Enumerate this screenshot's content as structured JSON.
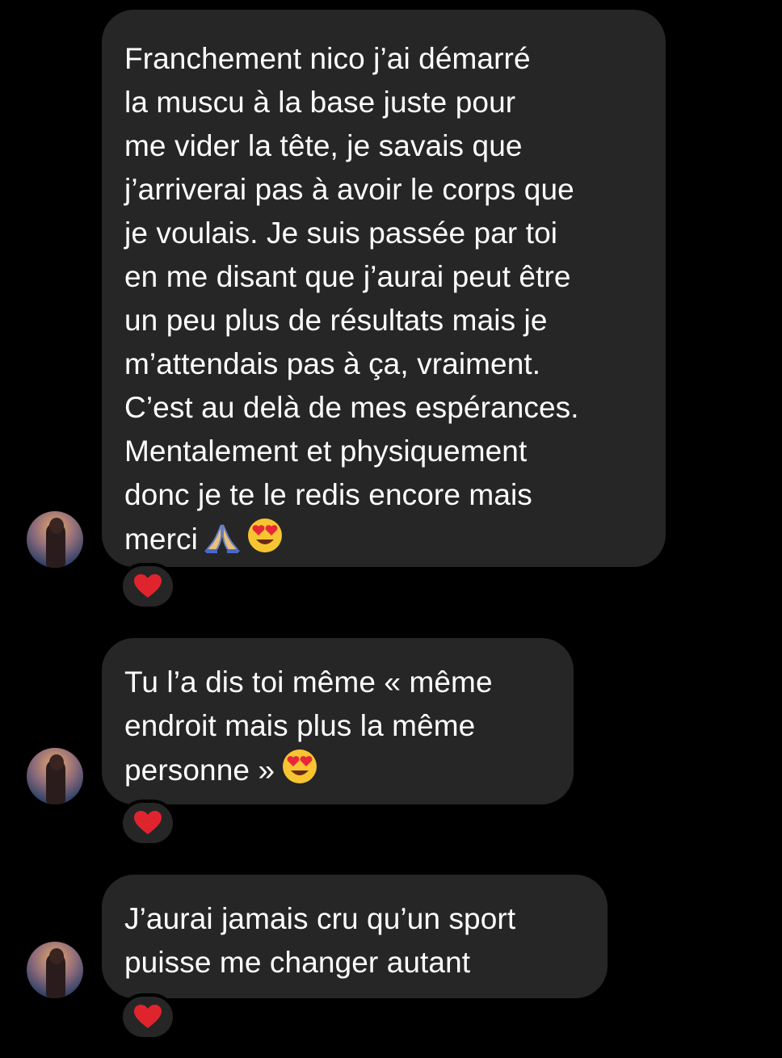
{
  "messages": [
    {
      "lines": [
        "Franchement nico j’ai démarré",
        "la muscu à la base juste pour",
        "me vider la tête, je savais que",
        "j’arriverai pas à avoir le corps que",
        "je voulais. Je suis passée par toi",
        "en me disant que j’aurai peut être",
        "un peu plus de résultats mais je",
        "m’attendais pas à ça, vraiment.",
        "C’est au delà de mes espérances.",
        "Mentalement et physiquement",
        "donc je te le redis encore mais",
        "merci"
      ],
      "trailing_emojis": [
        "folded-hands-icon",
        "heart-eyes-icon"
      ],
      "reaction": "red-heart-icon"
    },
    {
      "lines": [
        "Tu l’a dis toi même « même",
        "endroit mais plus la même",
        "personne »"
      ],
      "trailing_emojis": [
        "heart-eyes-icon"
      ],
      "reaction": "red-heart-icon"
    },
    {
      "lines": [
        "J’aurai jamais cru qu’un sport",
        "puisse me changer autant"
      ],
      "trailing_emojis": [],
      "reaction": "red-heart-icon"
    }
  ],
  "colors": {
    "background": "#000000",
    "bubble": "#262626",
    "text": "#ffffff",
    "heart": "#e0242e",
    "emoji_face": "#f7c531"
  }
}
